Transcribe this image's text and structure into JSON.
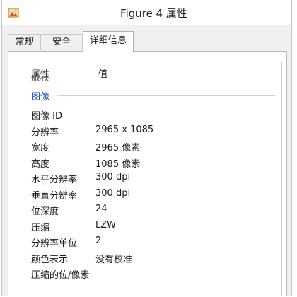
{
  "window": {
    "title": "Figure 4 属性",
    "icon": "image-file-icon"
  },
  "tabs": [
    {
      "label": "常规",
      "active": false
    },
    {
      "label": "安全",
      "active": false
    },
    {
      "label": "详细信息",
      "active": true
    }
  ],
  "list": {
    "columns": {
      "property": "属性",
      "value": "值"
    },
    "partial_row": "版权",
    "group": "图像",
    "rows": [
      {
        "property": "图像 ID",
        "value": ""
      },
      {
        "property": "分辨率",
        "value": "2965 x 1085"
      },
      {
        "property": "宽度",
        "value": "2965 像素"
      },
      {
        "property": "高度",
        "value": "1085 像素"
      },
      {
        "property": "水平分辨率",
        "value": "300 dpi"
      },
      {
        "property": "垂直分辨率",
        "value": "300 dpi"
      },
      {
        "property": "位深度",
        "value": "24"
      },
      {
        "property": "压缩",
        "value": "LZW"
      },
      {
        "property": "分辨率单位",
        "value": "2"
      },
      {
        "property": "颜色表示",
        "value": "没有校准"
      },
      {
        "property": "压缩的位/像素",
        "value": ""
      }
    ]
  },
  "colors": {
    "group_label": "#1e4fa3",
    "window_border": "#b5c7e0"
  }
}
